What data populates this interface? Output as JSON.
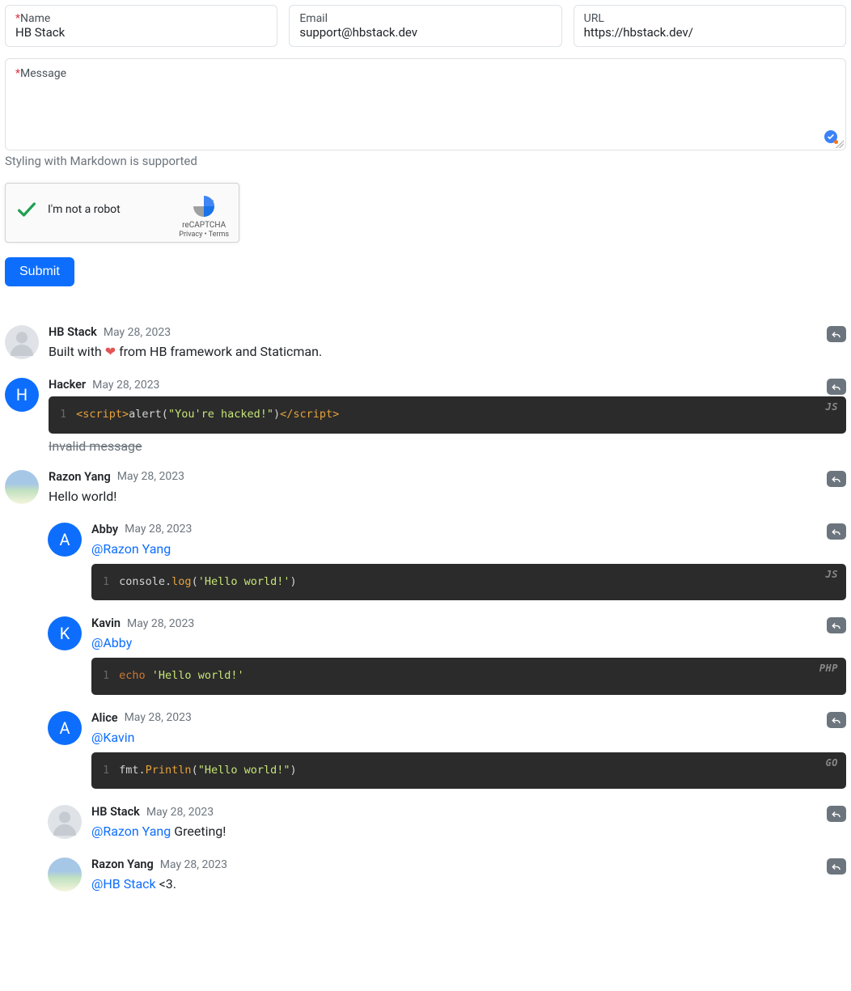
{
  "form": {
    "name_label": "Name",
    "name_value": "HB Stack",
    "email_label": "Email",
    "email_value": "support@hbstack.dev",
    "url_label": "URL",
    "url_value": "https://hbstack.dev/",
    "message_label": "Message",
    "markdown_hint": "Styling with Markdown is supported",
    "recaptcha_label": "I'm not a robot",
    "recaptcha_brand": "reCAPTCHA",
    "recaptcha_privacy": "Privacy",
    "recaptcha_terms": "Terms",
    "submit_label": "Submit",
    "required_marker": "*"
  },
  "comments": [
    {
      "id": "c1",
      "author": "HB Stack",
      "date": "May 28, 2023",
      "avatar": "gray",
      "initial": "",
      "nested": false,
      "body_pre": "Built with ",
      "heart": "❤",
      "body_post": " from HB framework and Staticman."
    },
    {
      "id": "c2",
      "author": "Hacker",
      "date": "May 28, 2023",
      "avatar": "blue",
      "initial": "H",
      "nested": false,
      "code_lang": "JS",
      "code_html": "<span class='c-tag'>&lt;script&gt;</span><span class='c-txt'>alert(</span><span class='c-str'>\"You're hacked!\"</span><span class='c-txt'>)</span><span class='c-tag'>&lt;/script&gt;</span>",
      "strike": "Invalid message"
    },
    {
      "id": "c3",
      "author": "Razon Yang",
      "date": "May 28, 2023",
      "avatar": "img",
      "initial": "",
      "nested": false,
      "text": "Hello world!"
    },
    {
      "id": "c4",
      "author": "Abby",
      "date": "May 28, 2023",
      "avatar": "blue",
      "initial": "A",
      "nested": true,
      "mention": "@Razon Yang",
      "code_lang": "JS",
      "code_html": "<span class='c-txt'>console.</span><span class='c-fn'>log</span><span class='c-txt'>(</span><span class='c-str'>'Hello world!'</span><span class='c-txt'>)</span>"
    },
    {
      "id": "c5",
      "author": "Kavin",
      "date": "May 28, 2023",
      "avatar": "blue",
      "initial": "K",
      "nested": true,
      "mention": "@Abby",
      "code_lang": "PHP",
      "code_html": "<span class='c-kw'>echo</span> <span class='c-str'>'Hello world!'</span>"
    },
    {
      "id": "c6",
      "author": "Alice",
      "date": "May 28, 2023",
      "avatar": "blue",
      "initial": "A",
      "nested": true,
      "mention": "@Kavin",
      "code_lang": "GO",
      "code_html": "<span class='c-txt'>fmt.</span><span class='c-fn'>Println</span><span class='c-txt'>(</span><span class='c-str'>\"Hello world!\"</span><span class='c-txt'>)</span>"
    },
    {
      "id": "c7",
      "author": "HB Stack",
      "date": "May 28, 2023",
      "avatar": "gray",
      "initial": "",
      "nested": true,
      "mention": "@Razon Yang",
      "text_after": "  Greeting!"
    },
    {
      "id": "c8",
      "author": "Razon Yang",
      "date": "May 28, 2023",
      "avatar": "img",
      "initial": "",
      "nested": true,
      "mention": "@HB Stack",
      "text_after": "  <3."
    }
  ]
}
